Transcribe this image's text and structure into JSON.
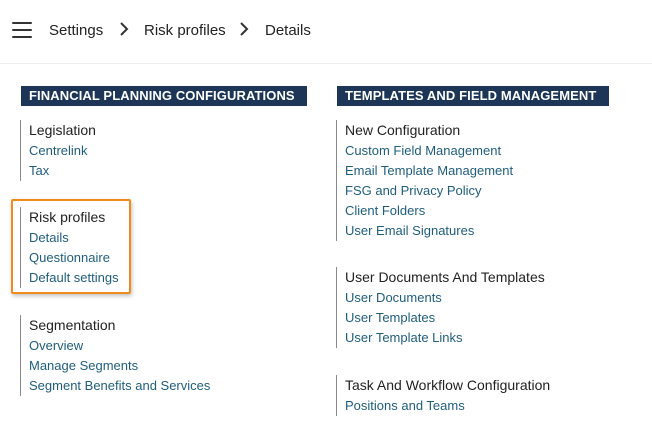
{
  "breadcrumb": {
    "items": [
      "Settings",
      "Risk profiles",
      "Details"
    ]
  },
  "sections": {
    "left": {
      "title": "FINANCIAL PLANNING CONFIGURATIONS",
      "groups": [
        {
          "title": "Legislation",
          "links": [
            "Centrelink",
            "Tax"
          ]
        },
        {
          "title": "Risk profiles",
          "links": [
            "Details",
            "Questionnaire",
            "Default settings"
          ]
        },
        {
          "title": "Segmentation",
          "links": [
            "Overview",
            "Manage Segments",
            "Segment Benefits and Services"
          ]
        }
      ]
    },
    "right": {
      "title": "TEMPLATES AND FIELD MANAGEMENT",
      "groups": [
        {
          "title": "New Configuration",
          "links": [
            "Custom Field Management",
            "Email Template Management",
            "FSG and Privacy Policy",
            "Client Folders",
            "User Email Signatures"
          ]
        },
        {
          "title": "User Documents And Templates",
          "links": [
            "User Documents",
            "User Templates",
            "User Template Links"
          ]
        },
        {
          "title": "Task And Workflow Configuration",
          "links": [
            "Positions and Teams"
          ]
        }
      ]
    }
  },
  "colors": {
    "header_bg": "#1d3557",
    "link": "#1f5d7d",
    "highlight": "#f08c1e"
  },
  "icons": {
    "menu": "hamburger-menu-icon",
    "separator": "chevron-right-icon"
  }
}
